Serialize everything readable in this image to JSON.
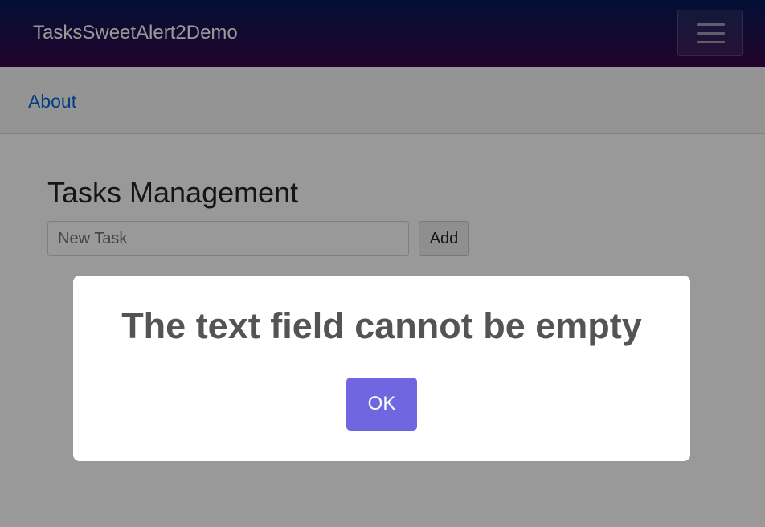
{
  "navbar": {
    "brand": "TasksSweetAlert2Demo",
    "toggler_icon": "hamburger-menu-icon"
  },
  "nav": {
    "about_label": "About"
  },
  "main": {
    "title": "Tasks Management",
    "task_input": {
      "placeholder": "New Task",
      "value": ""
    },
    "add_label": "Add"
  },
  "alert": {
    "title": "The text field cannot be empty",
    "ok_label": "OK"
  },
  "colors": {
    "navbar_gradient_top": "#051b5a",
    "navbar_gradient_bottom": "#3a0647",
    "link": "#0366d6",
    "confirm_button": "#7066e0",
    "overlay": "rgba(0,0,0,0.4)"
  }
}
